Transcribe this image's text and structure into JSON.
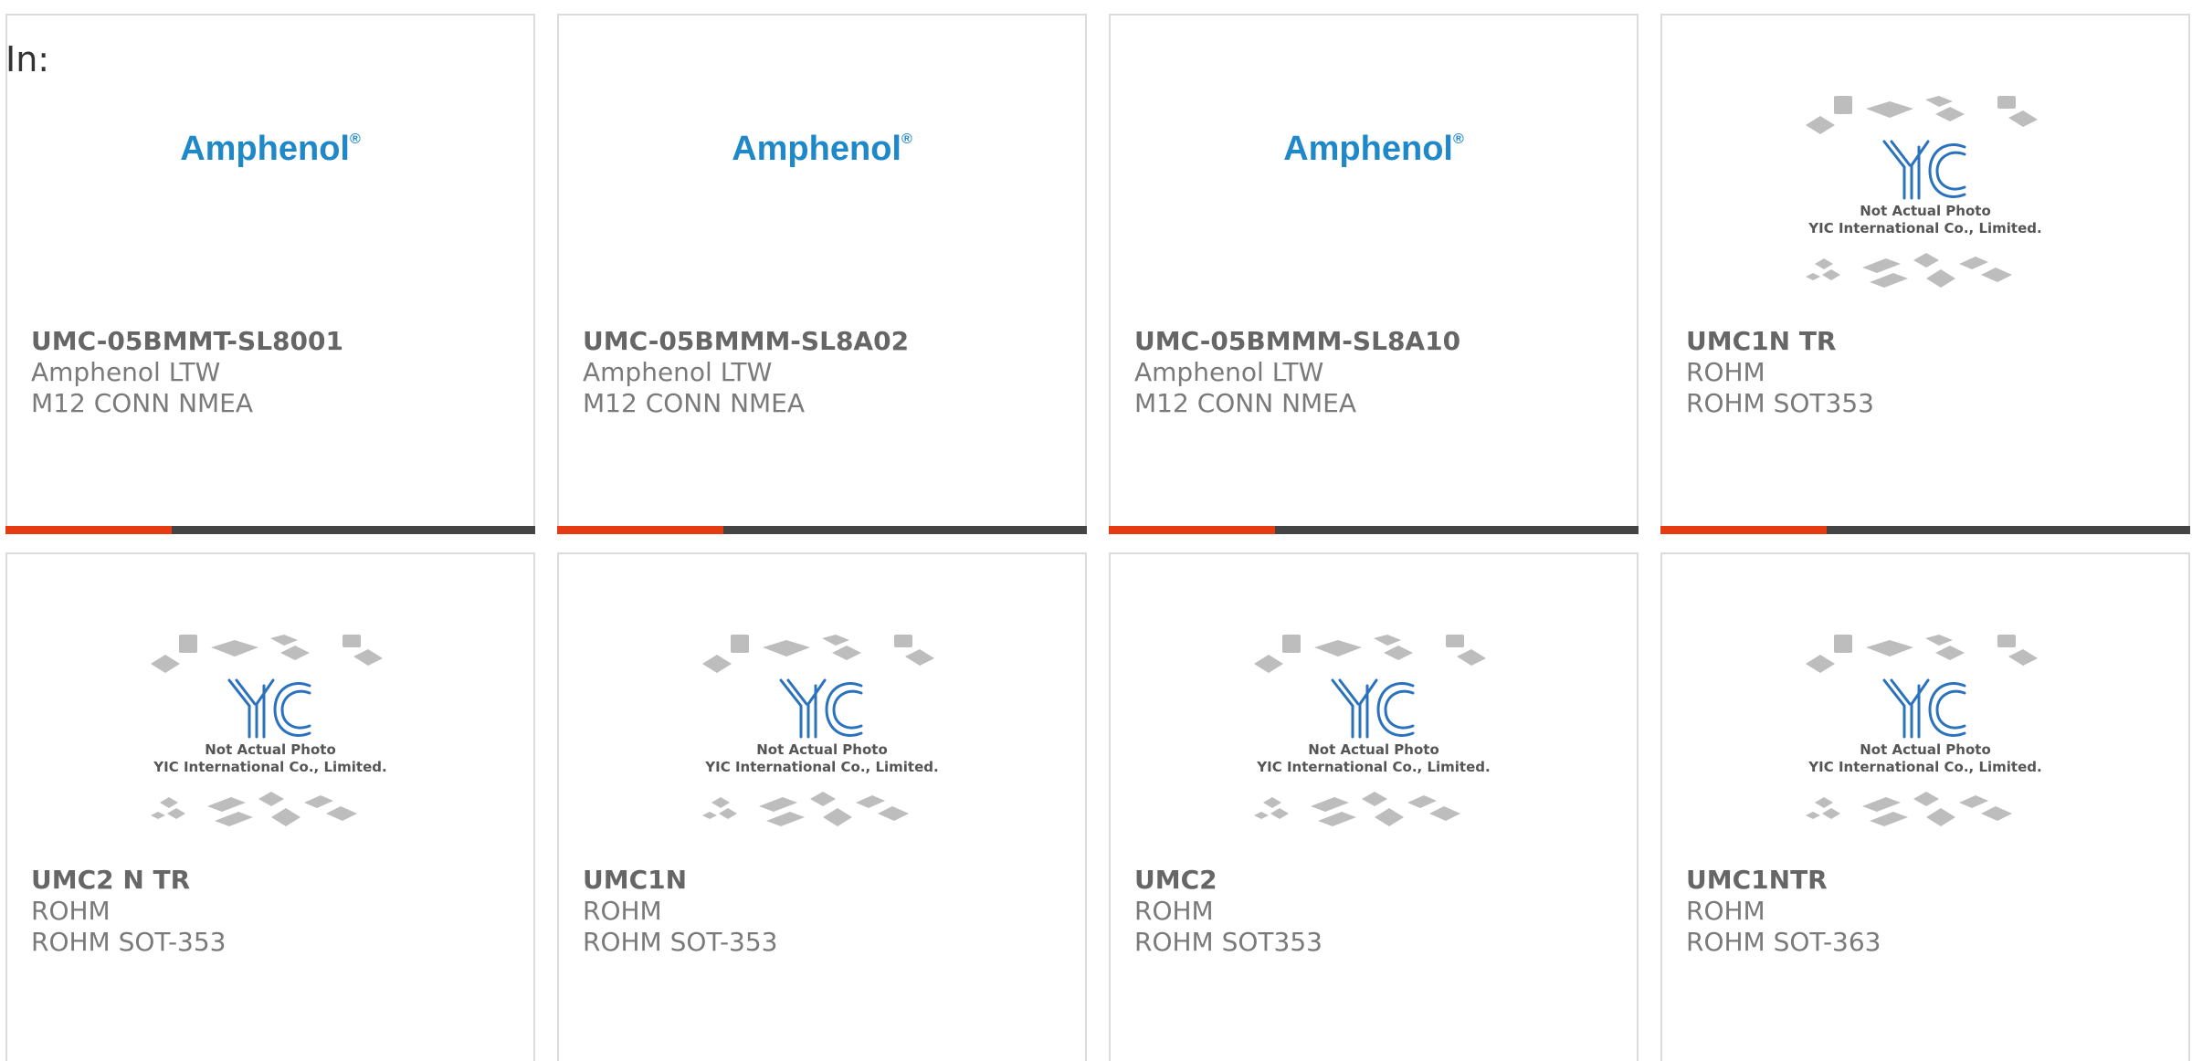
{
  "header": {
    "in_label": "In:"
  },
  "brand_logo_text": "Amphenol",
  "brand_logo_mark": "®",
  "placeholder_image": {
    "line1": "Not Actual Photo",
    "line2": "YIC International Co., Limited."
  },
  "colors": {
    "accent": "#e63a12",
    "bar_dark": "#444444",
    "amphenol_blue": "#1f88c9",
    "yic_blue": "#2a72bd",
    "chip_gray": "#bdbdbd"
  },
  "products": [
    {
      "part_number": "UMC-05BMMT-SL8001",
      "manufacturer": "Amphenol LTW",
      "description": "M12 CONN NMEA",
      "image": "amphenol-logo"
    },
    {
      "part_number": "UMC-05BMMM-SL8A02",
      "manufacturer": "Amphenol LTW",
      "description": "M12 CONN NMEA",
      "image": "amphenol-logo"
    },
    {
      "part_number": "UMC-05BMMM-SL8A10",
      "manufacturer": "Amphenol LTW",
      "description": "M12 CONN NMEA",
      "image": "amphenol-logo"
    },
    {
      "part_number": "UMC1N TR",
      "manufacturer": "ROHM",
      "description": "ROHM SOT353",
      "image": "yic-placeholder"
    },
    {
      "part_number": "UMC2 N TR",
      "manufacturer": "ROHM",
      "description": "ROHM SOT-353",
      "image": "yic-placeholder"
    },
    {
      "part_number": "UMC1N",
      "manufacturer": "ROHM",
      "description": "ROHM SOT-353",
      "image": "yic-placeholder"
    },
    {
      "part_number": "UMC2",
      "manufacturer": "ROHM",
      "description": "ROHM SOT353",
      "image": "yic-placeholder"
    },
    {
      "part_number": "UMC1NTR",
      "manufacturer": "ROHM",
      "description": "ROHM SOT-363",
      "image": "yic-placeholder"
    }
  ]
}
